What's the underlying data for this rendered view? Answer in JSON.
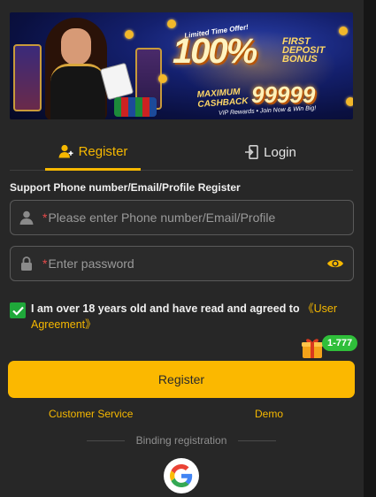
{
  "banner": {
    "limited": "Limited Time Offer!",
    "big_percent": "100%",
    "first_line1": "FIRST",
    "first_line2": "DEPOSIT",
    "first_line3": "BONUS",
    "max_line1": "MAXIMUM",
    "max_line2": "CASHBACK",
    "amount": "99999",
    "vip": "VIP Rewards • Join Now & Win Big!"
  },
  "tabs": [
    {
      "label": "Register",
      "icon": "add-user-icon",
      "active": true
    },
    {
      "label": "Login",
      "icon": "login-door-icon",
      "active": false
    }
  ],
  "form": {
    "hint": "Support Phone number/Email/Profile Register",
    "phone_placeholder": "Please enter Phone number/Email/Profile",
    "password_placeholder": "Enter password",
    "required_mark": "*"
  },
  "agreement": {
    "text": "I am over 18 years old and have read and agreed to",
    "link": "《User Agreement》",
    "checked": true
  },
  "promo": {
    "badge": "1-777"
  },
  "submit_label": "Register",
  "links": {
    "customer_service": "Customer Service",
    "demo": "Demo"
  },
  "binding": {
    "label": "Binding registration"
  },
  "colors": {
    "accent": "#f6b800",
    "check": "#1fa83a",
    "background": "#272727",
    "badge": "#2fbf3a"
  }
}
